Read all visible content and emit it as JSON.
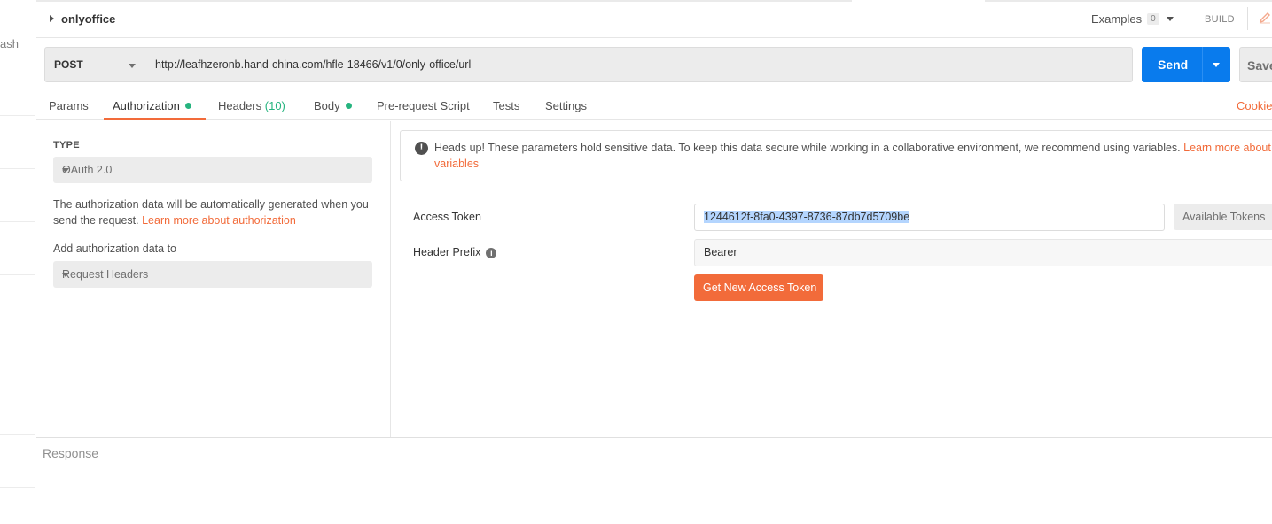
{
  "sidebar": {
    "fragment_text": "ash"
  },
  "header": {
    "collection_name": "onlyoffice",
    "examples_label": "Examples",
    "examples_count": "0",
    "build_label": "BUILD"
  },
  "request": {
    "method": "POST",
    "url": "http://leafhzeronb.hand-china.com/hfle-18466/v1/0/only-office/url",
    "send_label": "Send",
    "save_label": "Save"
  },
  "tabs": {
    "params": "Params",
    "authorization": "Authorization",
    "headers": "Headers",
    "headers_count": "(10)",
    "body": "Body",
    "prerequest": "Pre-request Script",
    "tests": "Tests",
    "settings": "Settings",
    "cookies": "Cookies"
  },
  "auth_config": {
    "type_label": "TYPE",
    "type_value": "OAuth 2.0",
    "description": "The authorization data will be automatically generated when you send the request.",
    "description_link": "Learn more about authorization",
    "add_to_label": "Add authorization data to",
    "add_to_value": "Request Headers"
  },
  "alert": {
    "text": "Heads up! These parameters hold sensitive data. To keep this data secure while working in a collaborative environment, we recommend using variables.",
    "link_line1": "Learn more about",
    "link_line2": "variables"
  },
  "auth_fields": {
    "access_token_label": "Access Token",
    "access_token_value": "1244612f-8fa0-4397-8736-87db7d5709be",
    "available_tokens_label": "Available Tokens",
    "header_prefix_label": "Header Prefix",
    "header_prefix_value": "Bearer",
    "get_token_label": "Get New Access Token"
  },
  "response": {
    "label": "Response"
  },
  "colors": {
    "accent_orange": "#f26b3a",
    "send_blue": "#097bed",
    "status_green": "#26b47f"
  }
}
